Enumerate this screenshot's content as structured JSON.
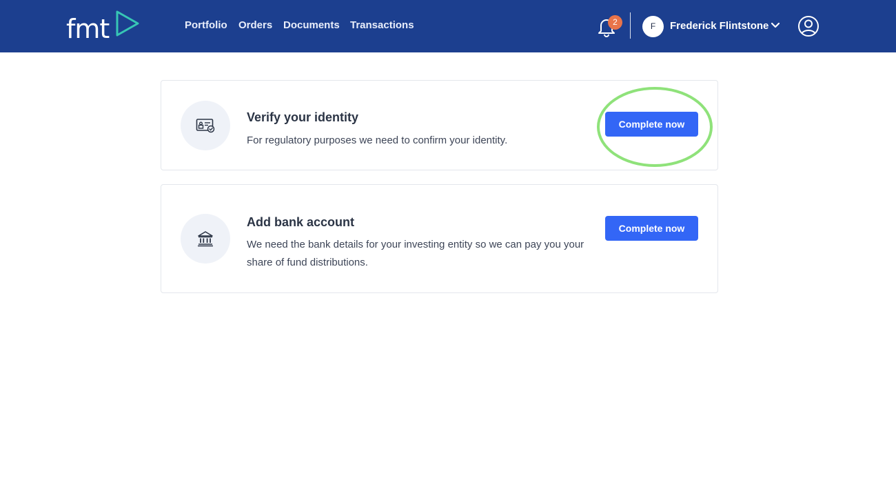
{
  "app": {
    "logo_text": "fmt",
    "colors": {
      "header_bg": "#1c3f8f",
      "primary": "#3366f6",
      "badge": "#e8744a",
      "highlight": "#8fe27a"
    }
  },
  "nav": {
    "items": [
      {
        "label": "Portfolio"
      },
      {
        "label": "Orders"
      },
      {
        "label": "Documents"
      },
      {
        "label": "Transactions"
      }
    ]
  },
  "notifications": {
    "count": "2",
    "icon": "bell-icon"
  },
  "user": {
    "initial": "F",
    "name": "Frederick Flintstone",
    "icon": "user-circle-icon"
  },
  "tasks": [
    {
      "title": "Verify your identity",
      "description": "For regulatory purposes we need to confirm your identity.",
      "button": "Complete now",
      "icon": "id-card-check-icon"
    },
    {
      "title": "Add bank account",
      "description": "We need the bank details for your investing entity so we can pay you your share of fund distributions.",
      "button": "Complete now",
      "icon": "bank-icon"
    }
  ]
}
